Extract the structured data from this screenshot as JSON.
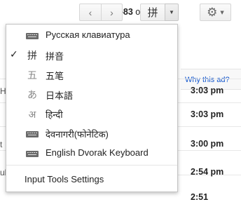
{
  "toolbar": {
    "pager": {
      "range": "1–83",
      "of_text": "of",
      "total": "83"
    },
    "prev_icon": "‹",
    "next_icon": "›",
    "ime_glyph": "拼",
    "dropdown_caret": "▼",
    "gear_icon": "⚙",
    "gear_caret": "▼"
  },
  "background": {
    "ad_link": "Why this ad?",
    "times": [
      "3:03 pm",
      "3:03 pm",
      "3:00 pm",
      "2:54 pm",
      "2:51"
    ],
    "edge_chars": [
      "H",
      "t",
      "ul"
    ]
  },
  "menu": {
    "items": [
      {
        "icon": "keyboard-icon",
        "glyph": "",
        "label": "Русская клавиатура",
        "checked": false
      },
      {
        "icon": "pinyin-icon",
        "glyph": "拼",
        "label": "拼音",
        "checked": true,
        "check": "✓"
      },
      {
        "icon": "wubi-icon",
        "glyph": "五",
        "label": "五笔",
        "checked": false
      },
      {
        "icon": "japanese-icon",
        "glyph": "あ",
        "label": "日本語",
        "checked": false
      },
      {
        "icon": "hindi-icon",
        "glyph": "अ",
        "label": "हिन्दी",
        "checked": false
      },
      {
        "icon": "keyboard-icon",
        "glyph": "",
        "label": "देवनागरी(फोनेटिक)",
        "checked": false
      },
      {
        "icon": "keyboard-icon",
        "glyph": "",
        "label": "English Dvorak Keyboard",
        "checked": false
      }
    ],
    "settings_label": "Input Tools Settings"
  }
}
